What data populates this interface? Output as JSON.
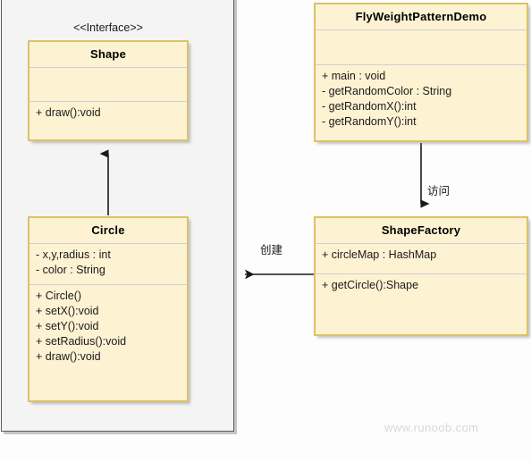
{
  "diagram": {
    "type": "uml-class-diagram",
    "title_watermark": "www.runoob.com",
    "colors": {
      "canvas_bg": "#fdfdfd",
      "package_bg": "#f4f4f4",
      "package_border": "#5a5a5a",
      "class_fill": "#fdf3d3",
      "class_border": "#dcc268",
      "compartment_divider": "#cfcfcf",
      "connector": "#1a1a1a",
      "watermark": "#d8d8d8"
    }
  },
  "classes": {
    "shape": {
      "stereotype": "<<Interface>>",
      "name": "Shape",
      "attributes": [],
      "methods": [
        "+ draw():void"
      ]
    },
    "circle": {
      "name": "Circle",
      "attributes": [
        "- x,y,radius : int",
        "- color : String"
      ],
      "methods": [
        "+ Circle()",
        "+ setX():void",
        "+ setY():void",
        "+ setRadius():void",
        "+ draw():void"
      ]
    },
    "demo": {
      "name": "FlyWeightPatternDemo",
      "attributes": [],
      "methods": [
        "+ main : void",
        "- getRandomColor : String",
        "- getRandomX():int",
        "- getRandomY():int"
      ]
    },
    "factory": {
      "name": "ShapeFactory",
      "attributes": [
        "+ circleMap : HashMap"
      ],
      "methods": [
        "+ getCircle():Shape"
      ]
    }
  },
  "relations": {
    "circle_implements_shape": {
      "label": "",
      "kind": "generalization",
      "from": "Circle",
      "to": "Shape"
    },
    "demo_uses_factory": {
      "label": "访问",
      "kind": "association",
      "from": "FlyWeightPatternDemo",
      "to": "ShapeFactory"
    },
    "factory_creates_circle": {
      "label": "创建",
      "kind": "association",
      "from": "ShapeFactory",
      "to": "Circle"
    }
  }
}
